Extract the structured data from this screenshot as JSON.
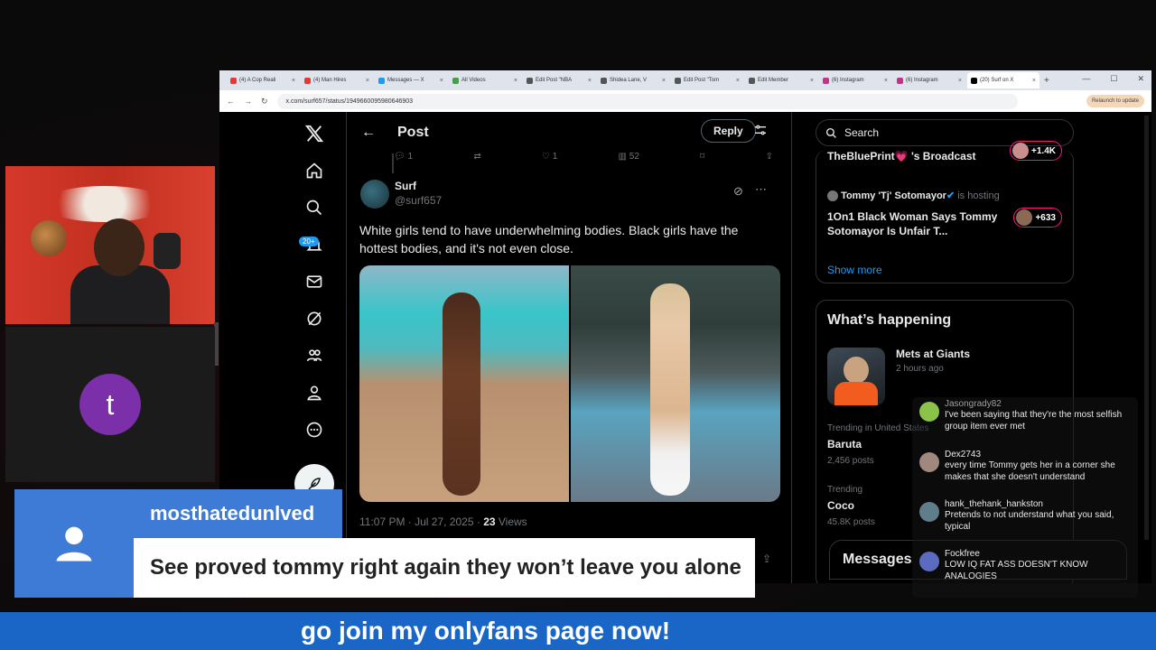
{
  "browser": {
    "tabs": [
      {
        "label": "(4) A Cop Reali",
        "color": "#e53935"
      },
      {
        "label": "(4) Man Hires",
        "color": "#e53935"
      },
      {
        "label": "Messages — X",
        "color": "#1d9bf0"
      },
      {
        "label": "All Videos",
        "color": "#43a047"
      },
      {
        "label": "Edit Post \"NBA",
        "color": "#555"
      },
      {
        "label": "Shidea Lane, V",
        "color": "#555"
      },
      {
        "label": "Edit Post \"Tom",
        "color": "#555"
      },
      {
        "label": "Edit Member",
        "color": "#555"
      },
      {
        "label": "(6) Instagram",
        "color": "#c13584"
      },
      {
        "label": "(6) Instagram",
        "color": "#c13584"
      },
      {
        "label": "(20) Surf on X",
        "color": "#000"
      }
    ],
    "url": "x.com/surf657/status/1949660095980646903",
    "relaunch_label": "Relaunch to update"
  },
  "x": {
    "nav_badge": "20+",
    "header_title": "Post",
    "reply_label": "Reply",
    "action_counts": {
      "replies": "1",
      "reposts": "",
      "likes": "1",
      "views": "52"
    },
    "author_name": "Surf",
    "author_handle": "@surf657",
    "post_text": "White girls tend to have underwhelming bodies. Black girls have the hottest bodies, and it's not even close.",
    "timestamp": "11:07 PM · Jul 27, 2025 · ",
    "views_count": "23",
    "views_label": " Views",
    "search_placeholder": "Search",
    "spaces": [
      {
        "title": "TheBluePrint💗 's Broadcast",
        "count": "+1.4K"
      },
      {
        "host": "Tommy 'Tj' Sotomayor",
        "host_suffix": " is hosting",
        "title": "1On1 Black Woman Says Tommy Sotomayor Is Unfair T...",
        "count": "+633"
      }
    ],
    "show_more": "Show more",
    "happening_title": "What’s happening",
    "trends": [
      {
        "name": "Mets at Giants",
        "sub": "2 hours ago"
      },
      {
        "context": "Trending in United States",
        "name": "Baruta",
        "sub": "2,456 posts"
      },
      {
        "context": "Trending",
        "name": "Coco",
        "sub": "45.8K posts"
      }
    ],
    "messages_label": "Messages"
  },
  "chat": [
    {
      "user": "Jasongrady82",
      "msg": "I've been saying that they're the most selfish group item ever met",
      "color": "#8bc34a"
    },
    {
      "user": "Dex2743",
      "msg": "every time Tommy gets her in a corner she makes that she doesn't understand",
      "color": "#a1887f"
    },
    {
      "user": "hank_thehank_hankston",
      "msg": "Pretends to not understand what you said, typical",
      "color": "#607d8b"
    },
    {
      "user": "Fockfree",
      "msg": "LOW IQ FAT ASS DOESN'T KNOW ANALOGIES",
      "color": "#5c6bc0"
    }
  ],
  "guest_initial": "t",
  "lower_third": {
    "name": "mosthatedunlved",
    "message": "See proved tommy right again they won’t leave you alone"
  },
  "ticker": "go join my onlyfans page now!"
}
